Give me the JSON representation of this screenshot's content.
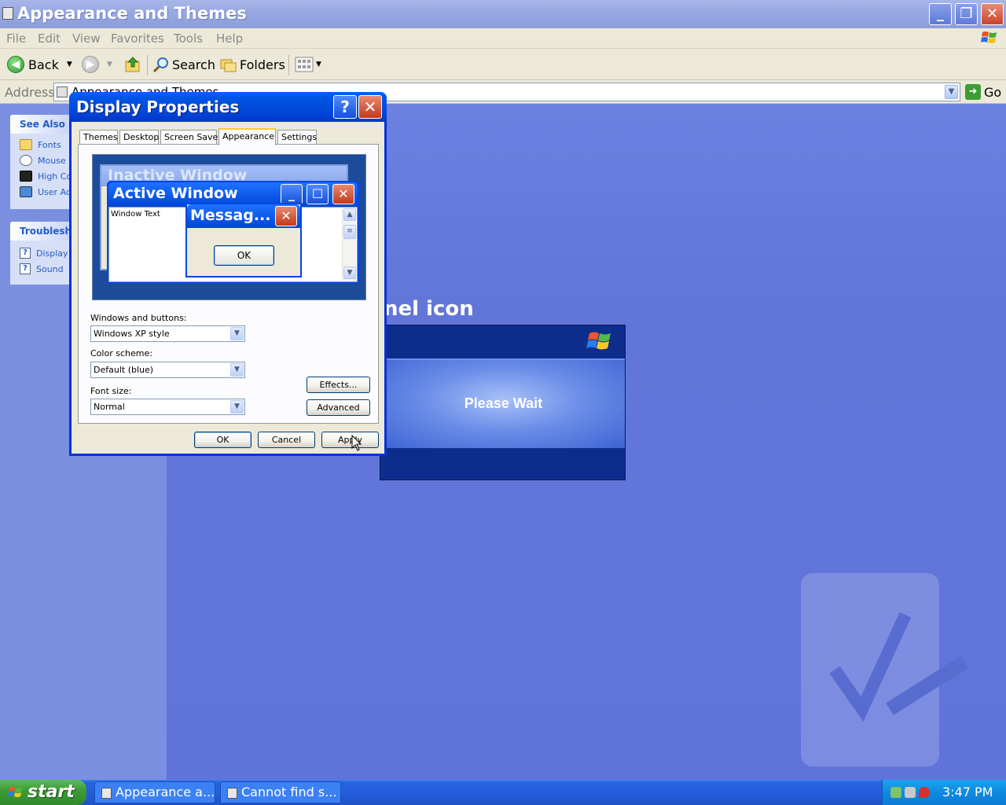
{
  "explorer": {
    "title": "Appearance and Themes",
    "menu": [
      "File",
      "Edit",
      "View",
      "Favorites",
      "Tools",
      "Help"
    ],
    "toolbar": {
      "back": "Back",
      "search": "Search",
      "folders": "Folders"
    },
    "address": {
      "label": "Address",
      "value": "Appearance and Themes",
      "go": "Go"
    },
    "see_also": {
      "title": "See Also",
      "items": [
        "Fonts",
        "Mouse P",
        "High Cor",
        "User Acc"
      ]
    },
    "troubleshoot": {
      "title": "Troubleshoo",
      "items": [
        "Display",
        "Sound"
      ]
    },
    "content_heading": "nel icon"
  },
  "splash": {
    "message": "Please Wait"
  },
  "dialog": {
    "title": "Display Properties",
    "help_glyph": "?",
    "tabs": [
      "Themes",
      "Desktop",
      "Screen Saver",
      "Appearance",
      "Settings"
    ],
    "active_tab": "Appearance",
    "preview": {
      "inactive_title": "Inactive Window",
      "active_title": "Active Window",
      "window_text": "Window Text",
      "message_title": "Messag...",
      "message_ok": "OK"
    },
    "windows_buttons": {
      "label": "Windows and buttons:",
      "value": "Windows XP style"
    },
    "color_scheme": {
      "label": "Color scheme:",
      "value": "Default (blue)"
    },
    "font_size": {
      "label": "Font size:",
      "value": "Normal"
    },
    "effects_button": "Effects...",
    "advanced_button": "Advanced",
    "ok_button": "OK",
    "cancel_button": "Cancel",
    "apply_button": "Apply"
  },
  "taskbar": {
    "start": "start",
    "tasks": [
      "Appearance a...",
      "Cannot find s..."
    ],
    "clock": "3:47 PM"
  },
  "colors": {
    "xp_blue": "#0048e0",
    "start_green": "#3c9c37",
    "desktop_blue": "#5f73da"
  }
}
